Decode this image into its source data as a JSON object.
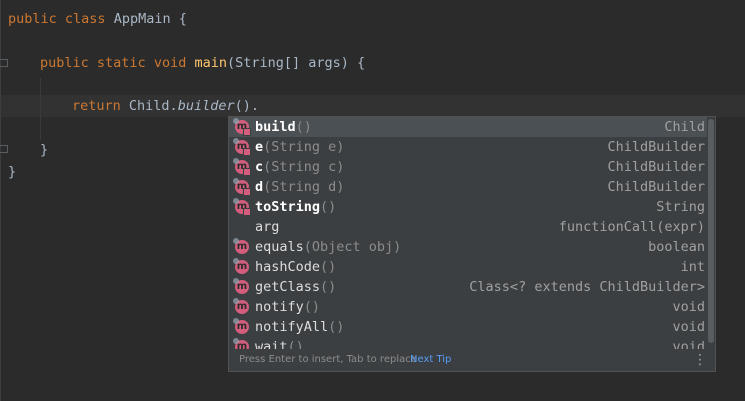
{
  "code": {
    "line1": {
      "kw1": "public",
      "kw2": "class",
      "name": "AppMain",
      "brace": "{"
    },
    "line2": {
      "kw1": "public",
      "kw2": "static",
      "kw3": "void",
      "fn": "main",
      "args": "(String[] args) {"
    },
    "line3": {
      "kw": "return",
      "cls": "Child.",
      "method": "builder",
      "tail": "()."
    },
    "line4": {
      "brace": "}"
    },
    "line5": {
      "brace": "}"
    }
  },
  "completion": {
    "items": [
      {
        "icon": "m",
        "name": "build",
        "params": "()",
        "ret": "Child",
        "selected": true,
        "bold": true
      },
      {
        "icon": "m",
        "name": "e",
        "params": "(String e)",
        "ret": "ChildBuilder",
        "bold": true
      },
      {
        "icon": "m",
        "name": "c",
        "params": "(String c)",
        "ret": "ChildBuilder",
        "bold": true
      },
      {
        "icon": "m",
        "name": "d",
        "params": "(String d)",
        "ret": "ChildBuilder",
        "bold": true
      },
      {
        "icon": "m",
        "name": "toString",
        "params": "()",
        "ret": "String",
        "bold": true
      },
      {
        "icon": "",
        "name": "arg",
        "params": "",
        "ret": "functionCall(expr)",
        "bold": false
      },
      {
        "icon": "m",
        "name": "equals",
        "params": "(Object obj)",
        "ret": "boolean",
        "bold": false
      },
      {
        "icon": "m",
        "name": "hashCode",
        "params": "()",
        "ret": "int",
        "bold": false
      },
      {
        "icon": "m",
        "name": "getClass",
        "params": "()",
        "ret": "Class<? extends ChildBuilder>",
        "bold": false
      },
      {
        "icon": "m",
        "name": "notify",
        "params": "()",
        "ret": "void",
        "bold": false
      },
      {
        "icon": "m",
        "name": "notifyAll",
        "params": "()",
        "ret": "void",
        "bold": false
      },
      {
        "icon": "m",
        "name": "wait",
        "params": "()",
        "ret": "void",
        "bold": false
      }
    ],
    "footer_hint": "Press Enter to insert, Tab to replace",
    "footer_tip": "Next Tip",
    "more_icon": "⋮"
  },
  "colors": {
    "keyword": "#cc7832",
    "method": "#ffc66d",
    "text": "#a9b7c6",
    "icon": "#d35d7c",
    "link": "#589df6"
  }
}
